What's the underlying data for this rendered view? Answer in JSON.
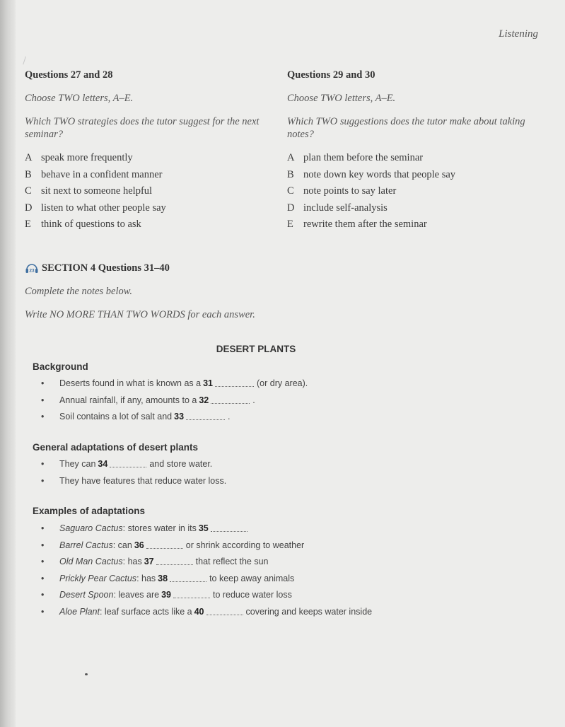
{
  "running_head": "Listening",
  "left_block": {
    "heading": "Questions 27 and 28",
    "instruction": "Choose TWO letters, A–E.",
    "question": "Which TWO strategies does the tutor suggest for the next seminar?",
    "options": [
      {
        "letter": "A",
        "text": "speak more frequently"
      },
      {
        "letter": "B",
        "text": "behave in a confident manner"
      },
      {
        "letter": "C",
        "text": "sit next to someone helpful"
      },
      {
        "letter": "D",
        "text": "listen to what other people say"
      },
      {
        "letter": "E",
        "text": "think of questions to ask"
      }
    ]
  },
  "right_block": {
    "heading": "Questions 29 and 30",
    "instruction": "Choose TWO letters, A–E.",
    "question": "Which TWO suggestions does the tutor make about taking notes?",
    "options": [
      {
        "letter": "A",
        "text": "plan them before the seminar"
      },
      {
        "letter": "B",
        "text": "note down key words that people say"
      },
      {
        "letter": "C",
        "text": "note points to say later"
      },
      {
        "letter": "D",
        "text": "include self-analysis"
      },
      {
        "letter": "E",
        "text": "rewrite them after the seminar"
      }
    ]
  },
  "section": {
    "audio_track": "23",
    "heading": "SECTION 4 Questions 31–40",
    "instruction_1": "Complete the notes below.",
    "instruction_2": "Write NO MORE THAN TWO WORDS for each answer."
  },
  "notes": {
    "title": "DESERT PLANTS",
    "background": {
      "heading": "Background",
      "items": [
        {
          "before": "Deserts found in what is known as a",
          "num": "31",
          "after": "(or dry area)."
        },
        {
          "before": "Annual rainfall, if any, amounts to a",
          "num": "32",
          "after": "."
        },
        {
          "before": "Soil contains a lot of salt and",
          "num": "33",
          "after": "."
        }
      ]
    },
    "general": {
      "heading": "General adaptations of desert plants",
      "items": [
        {
          "before": "They can",
          "num": "34",
          "after": "and store water."
        },
        {
          "text": "They have features that reduce water loss."
        }
      ]
    },
    "examples": {
      "heading": "Examples of adaptations",
      "items": [
        {
          "plant": "Saguaro Cactus",
          "before": ": stores water in its",
          "num": "35",
          "after": ""
        },
        {
          "plant": "Barrel Cactus",
          "before": ": can",
          "num": "36",
          "after": "or shrink according to weather"
        },
        {
          "plant": "Old Man Cactus",
          "before": ": has",
          "num": "37",
          "after": "that reflect the sun"
        },
        {
          "plant": "Prickly Pear Cactus",
          "before": ": has",
          "num": "38",
          "after": "to keep away animals"
        },
        {
          "plant": "Desert Spoon",
          "before": ": leaves are",
          "num": "39",
          "after": "to reduce water loss"
        },
        {
          "plant": "Aloe Plant",
          "before": ": leaf surface acts like a",
          "num": "40",
          "after": "covering and keeps water inside"
        }
      ]
    }
  }
}
